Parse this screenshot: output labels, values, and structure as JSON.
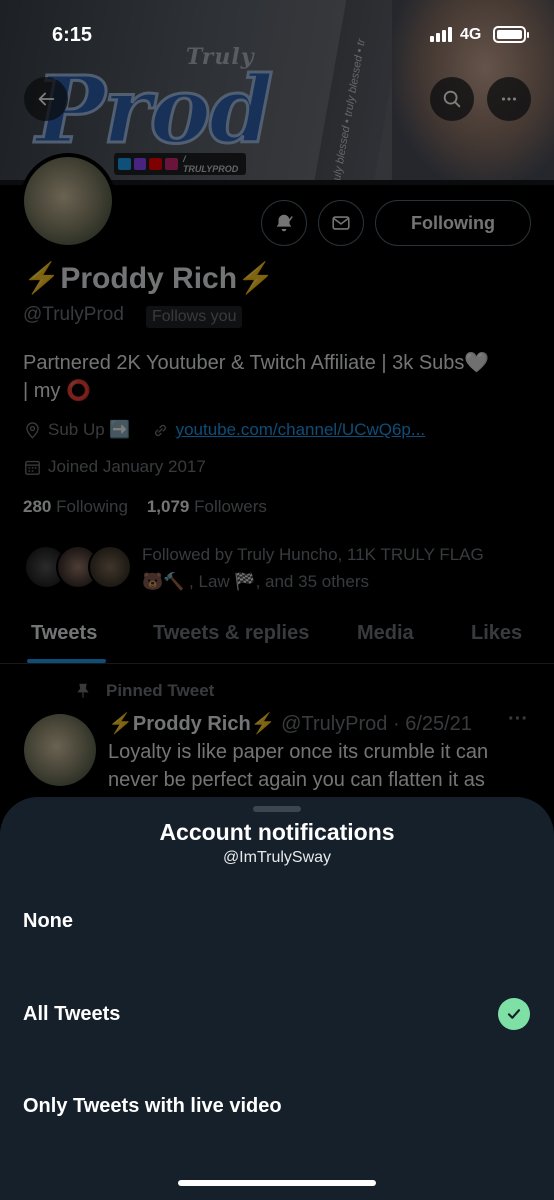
{
  "status_bar": {
    "time": "6:15",
    "network": "4G"
  },
  "banner": {
    "logo_small": "Truly",
    "logo_big": "Prod",
    "social_handle": "/ TRULYPROD",
    "side_text": "truly blessed • truly blessed • tr"
  },
  "profile": {
    "name": "Proddy Rich",
    "name_prefix_emoji": "⚡",
    "name_suffix_emoji": "⚡",
    "handle": "@TrulyProd",
    "follows_you": "Follows you",
    "follow_button": "Following",
    "bio_line1": "Partnered 2K Youtuber & Twitch Affiliate | 3k Subs🤍",
    "bio_line2": "| my ⭕",
    "location": "Sub Up ➡️",
    "website": "youtube.com/channel/UCwQ6p...",
    "joined": "Joined January 2017",
    "following_count": "280",
    "following_label": "Following",
    "followers_count": "1,079",
    "followers_label": "Followers",
    "followed_by_line1": "Followed by Truly Huncho, 11K TRULY FLAG",
    "followed_by_line2": "🐻🔨 , Law 🏁, and 35 others"
  },
  "tabs": [
    {
      "label": "Tweets",
      "active": true
    },
    {
      "label": "Tweets & replies",
      "active": false
    },
    {
      "label": "Media",
      "active": false
    },
    {
      "label": "Likes",
      "active": false
    }
  ],
  "pinned_tweet": {
    "pinned_label": "Pinned Tweet",
    "author_name": "⚡Proddy Rich⚡",
    "author_handle": "@TrulyProd",
    "date": "· 6/25/21",
    "more": "···",
    "text": "Loyalty is like paper once its crumble it can never be perfect again you can flatten it as"
  },
  "sheet": {
    "title": "Account notifications",
    "subtitle": "@ImTrulySway",
    "options": [
      {
        "label": "None",
        "selected": false
      },
      {
        "label": "All Tweets",
        "selected": true
      },
      {
        "label": "Only Tweets with live video",
        "selected": false
      }
    ]
  },
  "colors": {
    "background": "#000000",
    "sheet": "#15202b",
    "accent": "#1d9bf0",
    "check": "#7ee0a5",
    "muted_text": "#71767b"
  },
  "icons": [
    "back-arrow-icon",
    "search-icon",
    "more-icon",
    "bell-icon",
    "mail-icon",
    "location-icon",
    "link-icon",
    "calendar-icon",
    "pin-icon",
    "checkmark-icon"
  ]
}
